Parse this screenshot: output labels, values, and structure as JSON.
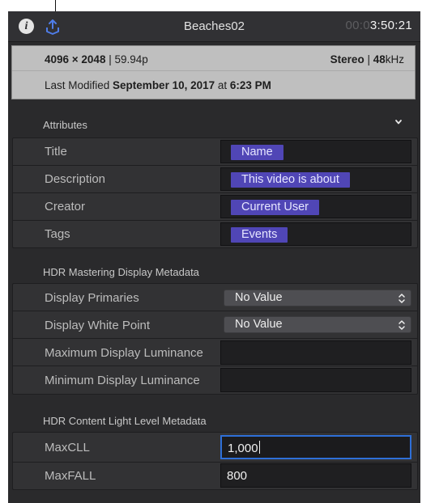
{
  "header": {
    "clip_name": "Beaches02",
    "timecode_dim": "00:0",
    "timecode_bright": "3:50:21"
  },
  "summary": {
    "resolution": "4096 × 2048",
    "frame_rate": " | 59.94p",
    "audio_channels": "Stereo",
    "audio_separator": " | ",
    "audio_rate_value": "48",
    "audio_rate_unit": "kHz",
    "modified_prefix": "Last Modified ",
    "modified_date": "September 10, 2017",
    "modified_at": " at ",
    "modified_time": "6:23 PM"
  },
  "attributes": {
    "label": "Attributes",
    "rows": [
      {
        "label": "Title",
        "token": "Name"
      },
      {
        "label": "Description",
        "token": "This video is about"
      },
      {
        "label": "Creator",
        "token": "Current User"
      },
      {
        "label": "Tags",
        "token": "Events"
      }
    ]
  },
  "hdr_display": {
    "label": "HDR Mastering Display Metadata",
    "rows": [
      {
        "label": "Display Primaries",
        "value": "No Value"
      },
      {
        "label": "Display White Point",
        "value": "No Value"
      },
      {
        "label": "Maximum Display Luminance",
        "value": ""
      },
      {
        "label": "Minimum Display Luminance",
        "value": ""
      }
    ]
  },
  "hdr_content": {
    "label": "HDR Content Light Level Metadata",
    "rows": [
      {
        "label": "MaxCLL",
        "value": "1,000"
      },
      {
        "label": "MaxFALL",
        "value": "800"
      }
    ]
  },
  "icons": {
    "info": "info-icon",
    "share": "share-icon",
    "collapse": "chevron-down-icon",
    "select": "stepper-arrows-icon"
  },
  "colors": {
    "token": "#5046b6",
    "focus": "#2e6fd8",
    "panel": "#2a2a2c"
  }
}
